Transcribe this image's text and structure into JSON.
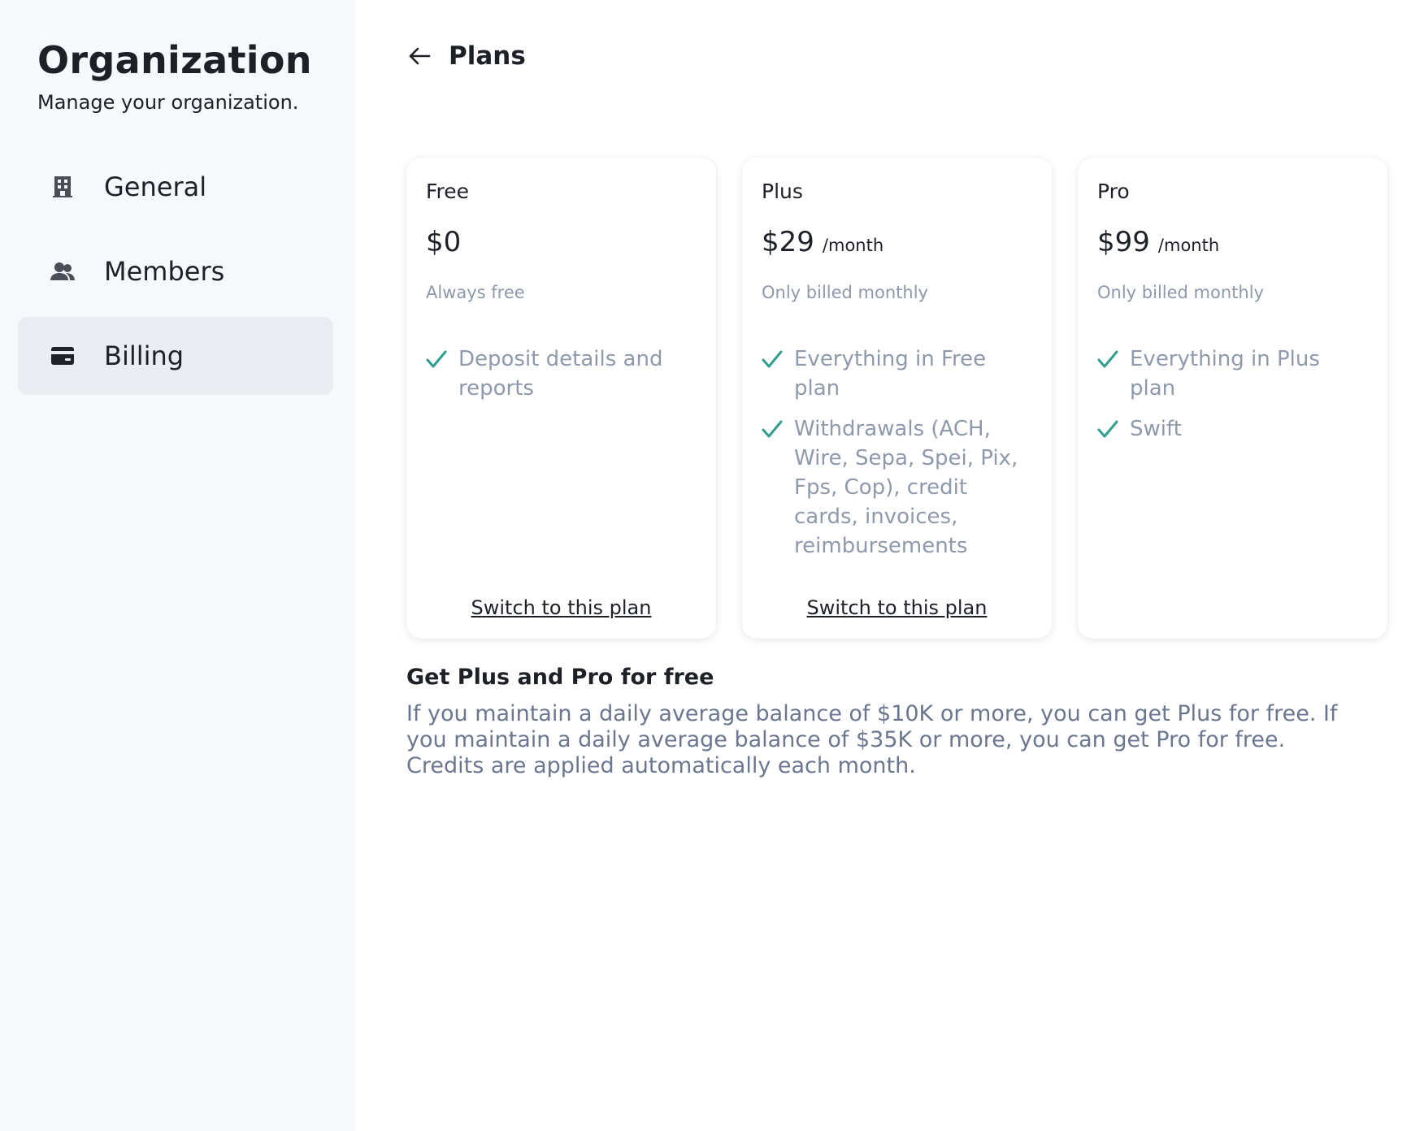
{
  "sidebar": {
    "title": "Organization",
    "subtitle": "Manage your organization.",
    "items": [
      {
        "label": "General",
        "icon": "building-icon",
        "active": false
      },
      {
        "label": "Members",
        "icon": "members-icon",
        "active": false
      },
      {
        "label": "Billing",
        "icon": "credit-card-icon",
        "active": true
      }
    ]
  },
  "header": {
    "back_icon": "arrow-left-icon",
    "title": "Plans"
  },
  "plans": [
    {
      "name": "Free",
      "price": "$0",
      "period": "",
      "note": "Always free",
      "features": [
        "Deposit details and reports"
      ],
      "action": "Switch to this plan"
    },
    {
      "name": "Plus",
      "price": "$29",
      "period": "/month",
      "note": "Only billed monthly",
      "features": [
        "Everything in Free plan",
        "Withdrawals (ACH, Wire, Sepa, Spei, Pix, Fps, Cop), credit cards, invoices, reimbursements"
      ],
      "action": "Switch to this plan"
    },
    {
      "name": "Pro",
      "price": "$99",
      "period": "/month",
      "note": "Only billed monthly",
      "features": [
        "Everything in Plus plan",
        "Swift"
      ],
      "action": ""
    }
  ],
  "promo": {
    "title": "Get Plus and Pro for free",
    "text": "If you maintain a daily average balance of $10K or more, you can get Plus for free. If you maintain a daily average balance of $35K or more, you can get Pro for free. Credits are applied automatically each month."
  },
  "colors": {
    "sidebar_bg": "#f6f8fc",
    "active_bg": "#e9ecf1",
    "check": "#2f9e8f",
    "muted_text": "#8e99ab",
    "promo_text": "#6b7790"
  }
}
